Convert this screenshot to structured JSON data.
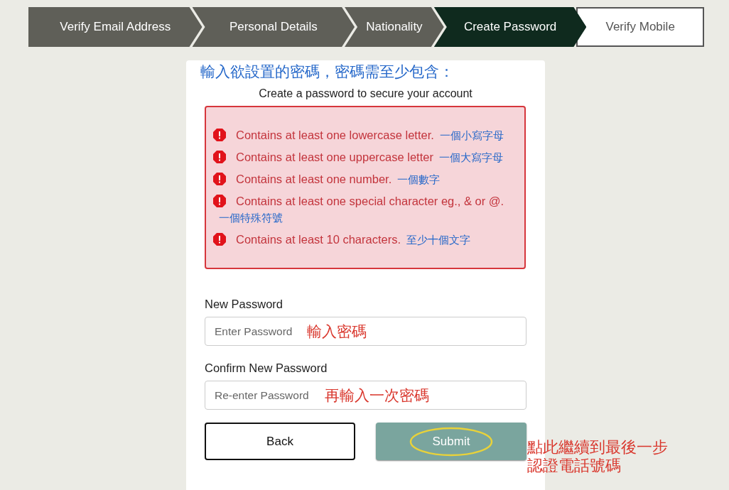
{
  "steps": [
    {
      "label": "Verify Email Address",
      "completed": true,
      "selected": false
    },
    {
      "label": "Personal Details",
      "completed": true,
      "selected": false
    },
    {
      "label": "Nationality",
      "completed": true,
      "selected": false
    },
    {
      "label": "Create Password",
      "completed": false,
      "selected": true
    },
    {
      "label": "Verify Mobile",
      "completed": false,
      "selected": false
    }
  ],
  "title_note": "輸入欲設置的密碼，密碼需至少包含：",
  "subtitle": "Create a password to secure your account",
  "rules": [
    {
      "text": "Contains at least one lowercase letter.",
      "note": "一個小寫字母",
      "met": false
    },
    {
      "text": "Contains at least one uppercase letter",
      "note": "一個大寫字母",
      "met": false
    },
    {
      "text": "Contains at least one number.",
      "note": "一個數字",
      "met": false
    },
    {
      "text": "Contains at least one special character eg., & or @.",
      "note": "一個特殊符號",
      "met": false
    },
    {
      "text": "Contains at least 10 characters.",
      "note": "至少十個文字",
      "met": false
    }
  ],
  "fields": [
    {
      "label": "New Password",
      "placeholder": "Enter Password",
      "note": "輸入密碼"
    },
    {
      "label": "Confirm New Password",
      "placeholder": "Re-enter Password",
      "note": "再輸入一次密碼"
    }
  ],
  "buttons": [
    {
      "label": "Back",
      "kind": "secondary"
    },
    {
      "label": "Submit",
      "kind": "primary",
      "circled": true
    }
  ],
  "submit_note": "點此繼續到最後一步認證電話號碼"
}
